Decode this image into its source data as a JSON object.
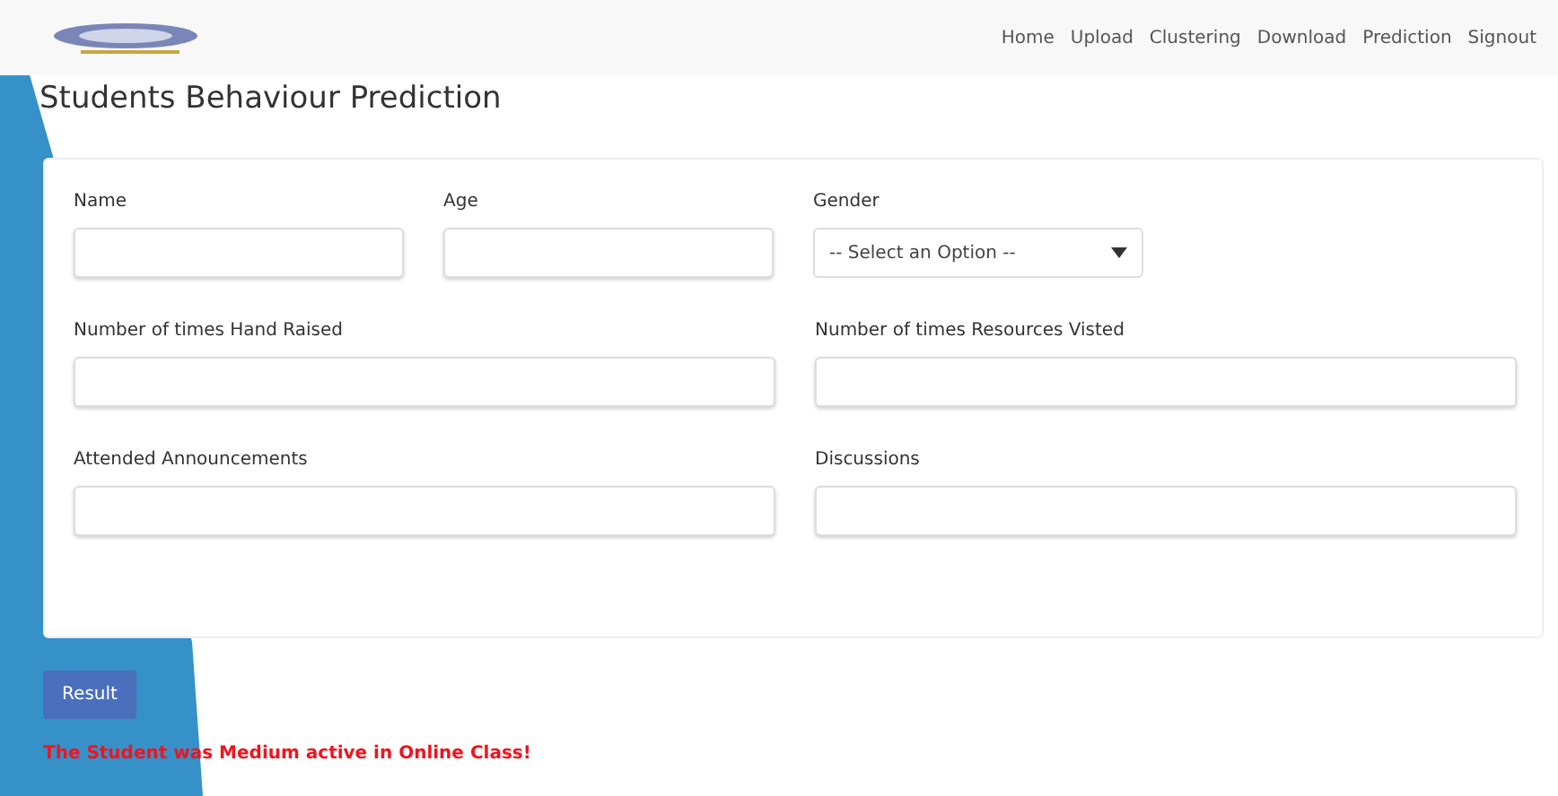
{
  "nav": {
    "links": [
      "Home",
      "Upload",
      "Clustering",
      "Download",
      "Prediction",
      "Signout"
    ]
  },
  "title": "Students Behaviour Prediction",
  "form": {
    "rows": [
      {
        "fields": [
          {
            "label": "Name",
            "kind": "input"
          },
          {
            "label": "Age",
            "kind": "input"
          },
          {
            "label": "Gender",
            "kind": "select",
            "value": "-- Select an Option --"
          }
        ]
      },
      {
        "fields": [
          {
            "label": "Number of times Hand Raised",
            "kind": "input"
          },
          {
            "label": "Number of times Resources Visted",
            "kind": "input"
          }
        ]
      },
      {
        "fields": [
          {
            "label": "Attended Announcements",
            "kind": "input"
          },
          {
            "label": "Discussions",
            "kind": "input"
          }
        ]
      }
    ]
  },
  "button": "Result",
  "result_message": "The Student was Medium active in Online Class!"
}
